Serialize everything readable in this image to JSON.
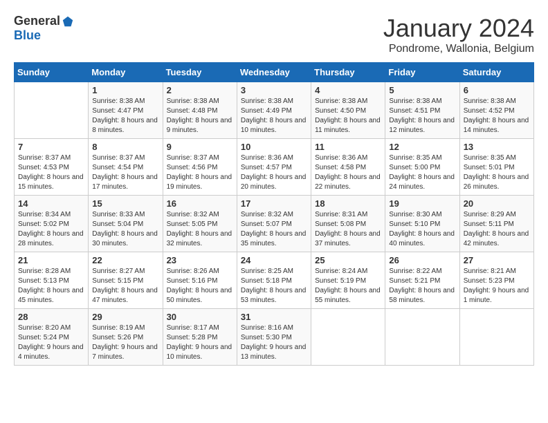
{
  "header": {
    "logo_general": "General",
    "logo_blue": "Blue",
    "month_title": "January 2024",
    "subtitle": "Pondrome, Wallonia, Belgium"
  },
  "calendar": {
    "days_of_week": [
      "Sunday",
      "Monday",
      "Tuesday",
      "Wednesday",
      "Thursday",
      "Friday",
      "Saturday"
    ],
    "weeks": [
      [
        {
          "num": "",
          "sunrise": "",
          "sunset": "",
          "daylight": ""
        },
        {
          "num": "1",
          "sunrise": "Sunrise: 8:38 AM",
          "sunset": "Sunset: 4:47 PM",
          "daylight": "Daylight: 8 hours and 8 minutes."
        },
        {
          "num": "2",
          "sunrise": "Sunrise: 8:38 AM",
          "sunset": "Sunset: 4:48 PM",
          "daylight": "Daylight: 8 hours and 9 minutes."
        },
        {
          "num": "3",
          "sunrise": "Sunrise: 8:38 AM",
          "sunset": "Sunset: 4:49 PM",
          "daylight": "Daylight: 8 hours and 10 minutes."
        },
        {
          "num": "4",
          "sunrise": "Sunrise: 8:38 AM",
          "sunset": "Sunset: 4:50 PM",
          "daylight": "Daylight: 8 hours and 11 minutes."
        },
        {
          "num": "5",
          "sunrise": "Sunrise: 8:38 AM",
          "sunset": "Sunset: 4:51 PM",
          "daylight": "Daylight: 8 hours and 12 minutes."
        },
        {
          "num": "6",
          "sunrise": "Sunrise: 8:38 AM",
          "sunset": "Sunset: 4:52 PM",
          "daylight": "Daylight: 8 hours and 14 minutes."
        }
      ],
      [
        {
          "num": "7",
          "sunrise": "Sunrise: 8:37 AM",
          "sunset": "Sunset: 4:53 PM",
          "daylight": "Daylight: 8 hours and 15 minutes."
        },
        {
          "num": "8",
          "sunrise": "Sunrise: 8:37 AM",
          "sunset": "Sunset: 4:54 PM",
          "daylight": "Daylight: 8 hours and 17 minutes."
        },
        {
          "num": "9",
          "sunrise": "Sunrise: 8:37 AM",
          "sunset": "Sunset: 4:56 PM",
          "daylight": "Daylight: 8 hours and 19 minutes."
        },
        {
          "num": "10",
          "sunrise": "Sunrise: 8:36 AM",
          "sunset": "Sunset: 4:57 PM",
          "daylight": "Daylight: 8 hours and 20 minutes."
        },
        {
          "num": "11",
          "sunrise": "Sunrise: 8:36 AM",
          "sunset": "Sunset: 4:58 PM",
          "daylight": "Daylight: 8 hours and 22 minutes."
        },
        {
          "num": "12",
          "sunrise": "Sunrise: 8:35 AM",
          "sunset": "Sunset: 5:00 PM",
          "daylight": "Daylight: 8 hours and 24 minutes."
        },
        {
          "num": "13",
          "sunrise": "Sunrise: 8:35 AM",
          "sunset": "Sunset: 5:01 PM",
          "daylight": "Daylight: 8 hours and 26 minutes."
        }
      ],
      [
        {
          "num": "14",
          "sunrise": "Sunrise: 8:34 AM",
          "sunset": "Sunset: 5:02 PM",
          "daylight": "Daylight: 8 hours and 28 minutes."
        },
        {
          "num": "15",
          "sunrise": "Sunrise: 8:33 AM",
          "sunset": "Sunset: 5:04 PM",
          "daylight": "Daylight: 8 hours and 30 minutes."
        },
        {
          "num": "16",
          "sunrise": "Sunrise: 8:32 AM",
          "sunset": "Sunset: 5:05 PM",
          "daylight": "Daylight: 8 hours and 32 minutes."
        },
        {
          "num": "17",
          "sunrise": "Sunrise: 8:32 AM",
          "sunset": "Sunset: 5:07 PM",
          "daylight": "Daylight: 8 hours and 35 minutes."
        },
        {
          "num": "18",
          "sunrise": "Sunrise: 8:31 AM",
          "sunset": "Sunset: 5:08 PM",
          "daylight": "Daylight: 8 hours and 37 minutes."
        },
        {
          "num": "19",
          "sunrise": "Sunrise: 8:30 AM",
          "sunset": "Sunset: 5:10 PM",
          "daylight": "Daylight: 8 hours and 40 minutes."
        },
        {
          "num": "20",
          "sunrise": "Sunrise: 8:29 AM",
          "sunset": "Sunset: 5:11 PM",
          "daylight": "Daylight: 8 hours and 42 minutes."
        }
      ],
      [
        {
          "num": "21",
          "sunrise": "Sunrise: 8:28 AM",
          "sunset": "Sunset: 5:13 PM",
          "daylight": "Daylight: 8 hours and 45 minutes."
        },
        {
          "num": "22",
          "sunrise": "Sunrise: 8:27 AM",
          "sunset": "Sunset: 5:15 PM",
          "daylight": "Daylight: 8 hours and 47 minutes."
        },
        {
          "num": "23",
          "sunrise": "Sunrise: 8:26 AM",
          "sunset": "Sunset: 5:16 PM",
          "daylight": "Daylight: 8 hours and 50 minutes."
        },
        {
          "num": "24",
          "sunrise": "Sunrise: 8:25 AM",
          "sunset": "Sunset: 5:18 PM",
          "daylight": "Daylight: 8 hours and 53 minutes."
        },
        {
          "num": "25",
          "sunrise": "Sunrise: 8:24 AM",
          "sunset": "Sunset: 5:19 PM",
          "daylight": "Daylight: 8 hours and 55 minutes."
        },
        {
          "num": "26",
          "sunrise": "Sunrise: 8:22 AM",
          "sunset": "Sunset: 5:21 PM",
          "daylight": "Daylight: 8 hours and 58 minutes."
        },
        {
          "num": "27",
          "sunrise": "Sunrise: 8:21 AM",
          "sunset": "Sunset: 5:23 PM",
          "daylight": "Daylight: 9 hours and 1 minute."
        }
      ],
      [
        {
          "num": "28",
          "sunrise": "Sunrise: 8:20 AM",
          "sunset": "Sunset: 5:24 PM",
          "daylight": "Daylight: 9 hours and 4 minutes."
        },
        {
          "num": "29",
          "sunrise": "Sunrise: 8:19 AM",
          "sunset": "Sunset: 5:26 PM",
          "daylight": "Daylight: 9 hours and 7 minutes."
        },
        {
          "num": "30",
          "sunrise": "Sunrise: 8:17 AM",
          "sunset": "Sunset: 5:28 PM",
          "daylight": "Daylight: 9 hours and 10 minutes."
        },
        {
          "num": "31",
          "sunrise": "Sunrise: 8:16 AM",
          "sunset": "Sunset: 5:30 PM",
          "daylight": "Daylight: 9 hours and 13 minutes."
        },
        {
          "num": "",
          "sunrise": "",
          "sunset": "",
          "daylight": ""
        },
        {
          "num": "",
          "sunrise": "",
          "sunset": "",
          "daylight": ""
        },
        {
          "num": "",
          "sunrise": "",
          "sunset": "",
          "daylight": ""
        }
      ]
    ]
  }
}
